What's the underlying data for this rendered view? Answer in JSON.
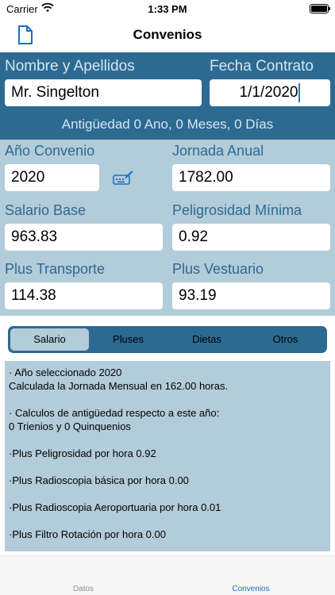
{
  "status": {
    "carrier": "Carrier",
    "time": "1:33 PM"
  },
  "nav": {
    "title": "Convenios",
    "icon": "document-icon"
  },
  "top": {
    "nombre_label": "Nombre y Apellidos",
    "nombre_value": "Mr. Singelton",
    "fecha_label": "Fecha Contrato",
    "fecha_value": "1/1/2020",
    "antiguedad": "Antigüedad 0 Ano, 0 Meses, 0 Días"
  },
  "form": {
    "ano_label": "Año Convenio",
    "ano_value": "2020",
    "jornada_label": "Jornada Anual",
    "jornada_value": "1782.00",
    "salario_label": "Salario Base",
    "salario_value": "963.83",
    "peligrosidad_label": "Peligrosidad Mínima",
    "peligrosidad_value": "0.92",
    "transporte_label": "Plus Transporte",
    "transporte_value": "114.38",
    "vestuario_label": "Plus Vestuario",
    "vestuario_value": "93.19"
  },
  "segments": [
    "Salario",
    "Pluses",
    "Dietas",
    "Otros"
  ],
  "selected_segment": "Salario",
  "info": {
    "l1": "· Año seleccionado 2020",
    "l2": "Calculada la Jornada Mensual en 162.00 horas.",
    "l3": "· Calculos de antigüedad respecto a este año:",
    "l4": "0 Trienios y 0 Quinquenios",
    "l5": "·Plus Peligrosidad por hora 0.92",
    "l6": "·Plus Radioscopia básica por hora 0.00",
    "l7": "·Plus Radioscopia Aeroportuaria por hora 0.01",
    "l8": "·Plus Filtro Rotación por hora 0.00"
  },
  "tabs": {
    "datos": "Datos",
    "convenios": "Convenios"
  },
  "colors": {
    "dark": "#2c6a92",
    "light": "#b3ccd9",
    "accent": "#1a6fc9"
  }
}
